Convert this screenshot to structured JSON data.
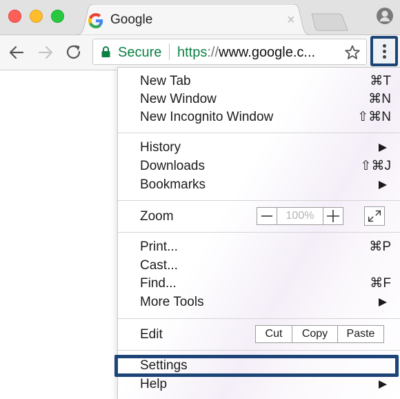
{
  "tab": {
    "title": "Google",
    "close": "×"
  },
  "address_bar": {
    "secure_label": "Secure",
    "url_scheme": "https",
    "url_separator": "://",
    "url_host": "www.google.c..."
  },
  "menu": {
    "new_tab": {
      "label": "New Tab",
      "shortcut": "⌘T"
    },
    "new_window": {
      "label": "New Window",
      "shortcut": "⌘N"
    },
    "new_incognito": {
      "label": "New Incognito Window",
      "shortcut": "⇧⌘N"
    },
    "history": {
      "label": "History"
    },
    "downloads": {
      "label": "Downloads",
      "shortcut": "⇧⌘J"
    },
    "bookmarks": {
      "label": "Bookmarks"
    },
    "zoom": {
      "label": "Zoom",
      "minus": "—",
      "value": "100%",
      "plus": "+"
    },
    "print": {
      "label": "Print...",
      "shortcut": "⌘P"
    },
    "cast": {
      "label": "Cast..."
    },
    "find": {
      "label": "Find...",
      "shortcut": "⌘F"
    },
    "more_tools": {
      "label": "More Tools"
    },
    "edit": {
      "label": "Edit",
      "cut": "Cut",
      "copy": "Copy",
      "paste": "Paste"
    },
    "settings": {
      "label": "Settings"
    },
    "help": {
      "label": "Help"
    }
  },
  "colors": {
    "secure_green": "#0b8043",
    "highlight_border": "#1d4477",
    "mac_close": "#fe5f57",
    "mac_minimize": "#ffbd2e",
    "mac_maximize": "#28c940"
  },
  "icons": {
    "window_controls": [
      "close-light",
      "minimize-light",
      "maximize-light"
    ],
    "tab": [
      "google-favicon",
      "tab-close-icon"
    ],
    "toolbar": [
      "back-arrow-icon",
      "forward-arrow-icon",
      "reload-icon",
      "lock-icon",
      "star-icon",
      "three-dot-menu-icon",
      "profile-icon"
    ],
    "menu": [
      "submenu-arrow-icon",
      "zoom-minus-icon",
      "zoom-plus-icon",
      "fullscreen-icon"
    ]
  }
}
